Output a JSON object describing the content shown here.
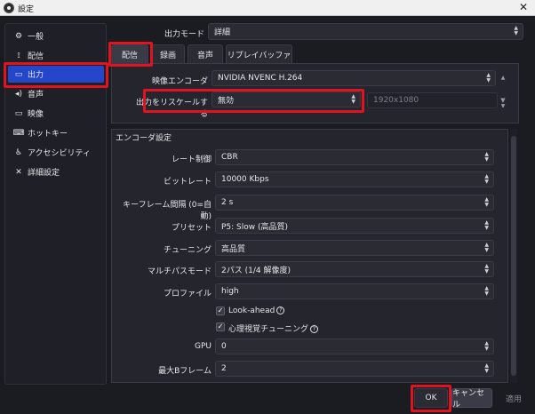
{
  "window": {
    "title": "設定",
    "close_label": "✕"
  },
  "sidebar": {
    "items": [
      {
        "label": "一般",
        "icon": "gear-icon",
        "glyph": "⚙"
      },
      {
        "label": "配信",
        "icon": "antenna-icon",
        "glyph": "⟟"
      },
      {
        "label": "出力",
        "icon": "monitor-icon",
        "glyph": "▭",
        "active": true
      },
      {
        "label": "音声",
        "icon": "speaker-icon",
        "glyph": "◂)"
      },
      {
        "label": "映像",
        "icon": "display-icon",
        "glyph": "▭"
      },
      {
        "label": "ホットキー",
        "icon": "keyboard-icon",
        "glyph": "⌨"
      },
      {
        "label": "アクセシビリティ",
        "icon": "accessibility-icon",
        "glyph": "♿"
      },
      {
        "label": "詳細設定",
        "icon": "tools-icon",
        "glyph": "✕"
      }
    ]
  },
  "output_mode": {
    "label": "出力モード",
    "value": "詳細"
  },
  "tabs": [
    "配信",
    "録画",
    "音声",
    "リプレイバッファ"
  ],
  "top_panel": {
    "video_encoder_label": "映像エンコーダ",
    "video_encoder_value": "NVIDIA NVENC H.264",
    "rescale_label": "出力をリスケールする",
    "rescale_value": "無効",
    "resolution_value": "1920x1080"
  },
  "encoder_settings": {
    "heading": "エンコーダ設定",
    "rate_control_label": "レート制御",
    "rate_control_value": "CBR",
    "bitrate_label": "ビットレート",
    "bitrate_value": "10000 Kbps",
    "keyframe_label": "キーフレーム間隔 (0=自動)",
    "keyframe_value": "2 s",
    "preset_label": "プリセット",
    "preset_value": "P5: Slow (高品質)",
    "tuning_label": "チューニング",
    "tuning_value": "高品質",
    "multipass_label": "マルチパスモード",
    "multipass_value": "2パス (1/4 解像度)",
    "profile_label": "プロファイル",
    "profile_value": "high",
    "lookahead_label": "Look-ahead",
    "psycho_label": "心理視覚チューニング",
    "gpu_label": "GPU",
    "gpu_value": "0",
    "bframes_label": "最大Bフレーム",
    "bframes_value": "2",
    "help_glyph": "?",
    "check_glyph": "✓"
  },
  "buttons": {
    "ok": "OK",
    "cancel": "キャンセル",
    "apply": "適用"
  },
  "colors": {
    "accent": "#2546c8",
    "highlight": "#e0141e",
    "background": "#1b1c21"
  }
}
